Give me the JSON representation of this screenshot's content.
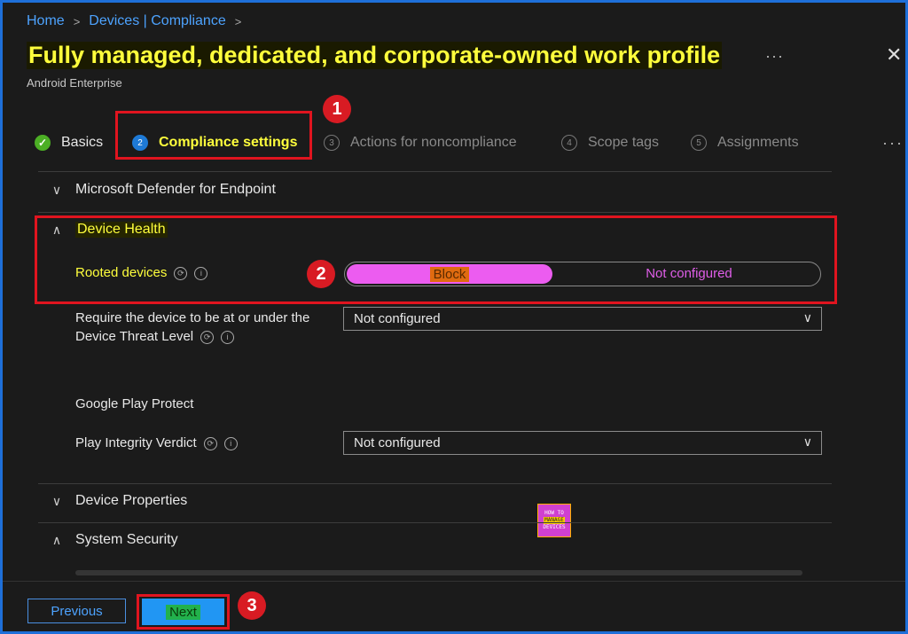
{
  "breadcrumb": {
    "home": "Home",
    "devices": "Devices | Compliance"
  },
  "header": {
    "title": "Fully managed, dedicated, and corporate-owned work profile",
    "subtitle": "Android Enterprise",
    "more": "···",
    "close": "✕"
  },
  "tabs": [
    {
      "num": "✓",
      "label": "Basics",
      "state": "done"
    },
    {
      "num": "2",
      "label": "Compliance settings",
      "state": "active"
    },
    {
      "num": "3",
      "label": "Actions for noncompliance",
      "state": "inactive"
    },
    {
      "num": "4",
      "label": "Scope tags",
      "state": "inactive"
    },
    {
      "num": "5",
      "label": "Assignments",
      "state": "inactive"
    }
  ],
  "tabs_more": "···",
  "annotations": {
    "one": "1",
    "two": "2",
    "three": "3"
  },
  "sections": {
    "defender": "Microsoft Defender for Endpoint",
    "device_health": "Device Health",
    "google_play": "Google Play Protect",
    "device_properties": "Device Properties",
    "system_security": "System Security"
  },
  "fields": {
    "rooted_devices": {
      "label": "Rooted devices",
      "options": [
        "Block",
        "Not configured"
      ],
      "selected": "Block"
    },
    "threat_level": {
      "label_line1": "Require the device to be at or under the",
      "label_line2": "Device Threat Level",
      "value": "Not configured"
    },
    "play_integrity": {
      "label": "Play Integrity Verdict",
      "value": "Not configured"
    }
  },
  "logo": {
    "top": "HOW TO",
    "mid": "MANAGE",
    "bottom": "DEVICES"
  },
  "footer": {
    "previous": "Previous",
    "next": "Next"
  },
  "colors": {
    "highlight_text": "#ffff3c",
    "annotation_red": "#e0141f",
    "toggle_selected": "#ec5cf0",
    "accent_blue": "#2196f3"
  }
}
